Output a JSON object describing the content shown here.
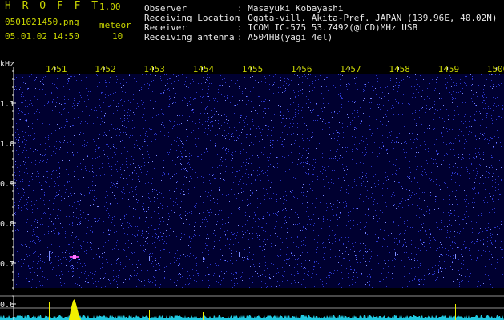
{
  "header": {
    "title": "H R O F F T",
    "version": "1.00",
    "filename": "0501021450.png",
    "datetime": "05.01.02 14:50",
    "meteor_label": "meteor",
    "meteor_count": "10"
  },
  "info": [
    {
      "label": "Observer",
      "value": ": Masayuki Kobayashi"
    },
    {
      "label": "Receiving Location",
      "value": ": Ogata-vill. Akita-Pref. JAPAN (139.96E, 40.02N)"
    },
    {
      "label": "Receiver",
      "value": ": ICOM IC-575 53.7492(@LCD)MHz USB"
    },
    {
      "label": "Receiving antenna",
      "value": ": A504HB(yagi 4el)"
    }
  ],
  "axis": {
    "unit": "kHz",
    "freq_ticks": [
      "1.1",
      "1.0",
      "0.9",
      "0.8",
      "0.7",
      "0.6"
    ],
    "time_ticks": [
      "1451",
      "1452",
      "1453",
      "1454",
      "1455",
      "1456",
      "1457",
      "1458",
      "1459",
      "1500"
    ]
  },
  "colors": {
    "background": "#000000",
    "text_yellow": "#c8d400",
    "text_white": "#e8e8e8",
    "noise": "#2a36c8",
    "echo": "#e040e0",
    "level_trace": "#20c8e0",
    "level_peak": "#f0f000"
  }
}
